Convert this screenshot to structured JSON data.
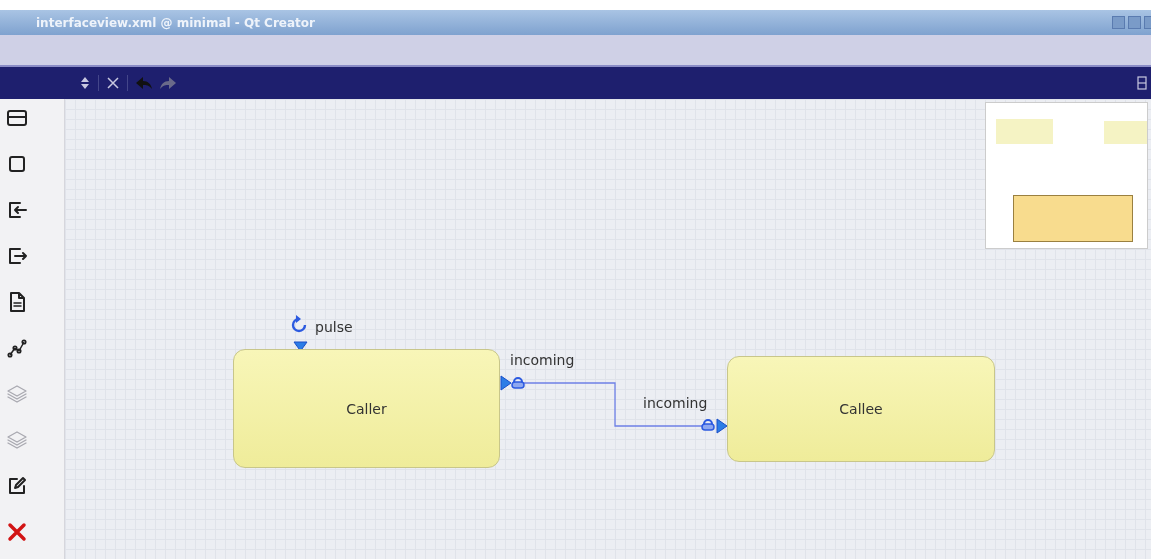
{
  "window": {
    "title": "interfaceview.xml @ minimal - Qt Creator"
  },
  "tools": [
    {
      "kind": "function-type",
      "disabled": false
    },
    {
      "kind": "function",
      "disabled": false
    },
    {
      "kind": "required-interface",
      "disabled": false
    },
    {
      "kind": "provided-interface",
      "disabled": false
    },
    {
      "kind": "comment",
      "disabled": false
    },
    {
      "kind": "connection",
      "disabled": false
    },
    {
      "kind": "layers",
      "disabled": true
    },
    {
      "kind": "layers",
      "disabled": true
    },
    {
      "kind": "edit",
      "disabled": false
    },
    {
      "kind": "delete",
      "disabled": false
    }
  ],
  "diagram": {
    "functions": [
      {
        "name": "Caller"
      },
      {
        "name": "Callee"
      }
    ],
    "cyclic_interface": {
      "label": "pulse"
    },
    "interfaces": [
      {
        "label": "incoming"
      },
      {
        "label": "incoming"
      }
    ]
  }
}
